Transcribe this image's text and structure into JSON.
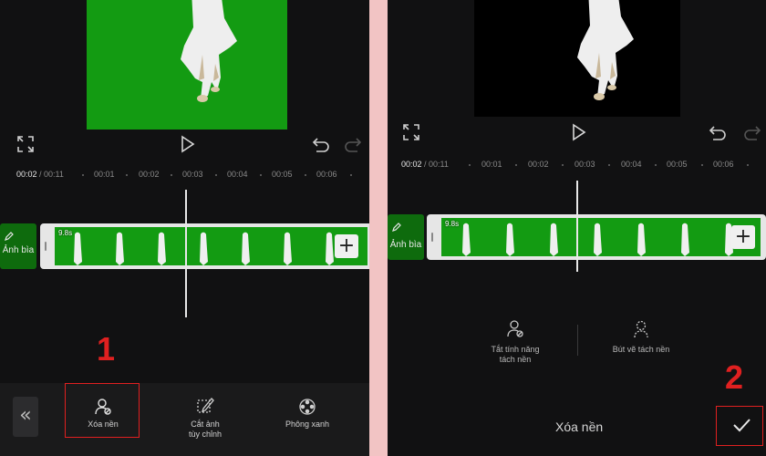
{
  "left": {
    "ruler": {
      "current_time": "00:02",
      "total_time": "/ 00:11",
      "ticks": [
        "00:01",
        "00:02",
        "00:03",
        "00:04",
        "00:05",
        "00:06"
      ]
    },
    "cover_label": "Ảnh bìa",
    "clip_duration": "9.8s",
    "toolbar": {
      "back_label": "«",
      "remove_bg_label": "Xóa nền",
      "custom_cut_label_1": "Cắt ảnh",
      "custom_cut_label_2": "tùy chỉnh",
      "chroma_key_label": "Phông xanh"
    },
    "step_number": "1"
  },
  "right": {
    "ruler": {
      "current_time": "00:02",
      "total_time": "/ 00:11",
      "ticks": [
        "00:01",
        "00:02",
        "00:03",
        "00:04",
        "00:05",
        "00:06"
      ]
    },
    "cover_label": "Ảnh bìa",
    "clip_duration": "9.8s",
    "options": {
      "turn_off_label_1": "Tắt tính năng",
      "turn_off_label_2": "tách nền",
      "brush_label": "Bút vẽ tách nền"
    },
    "bottom_title": "Xóa nền",
    "step_number": "2"
  },
  "colors": {
    "accent_red": "#e02020",
    "chroma_green": "#139b12",
    "background": "#111112",
    "separator_pink": "#f2c4c4"
  },
  "icons": {
    "fullscreen": "expand-corners",
    "play": "play-triangle",
    "undo": "undo-arrow",
    "redo": "redo-arrow",
    "remove_bg": "person-remove",
    "custom_cut": "crop-brush",
    "chroma_key": "dotted-circle",
    "confirm": "check-mark"
  }
}
